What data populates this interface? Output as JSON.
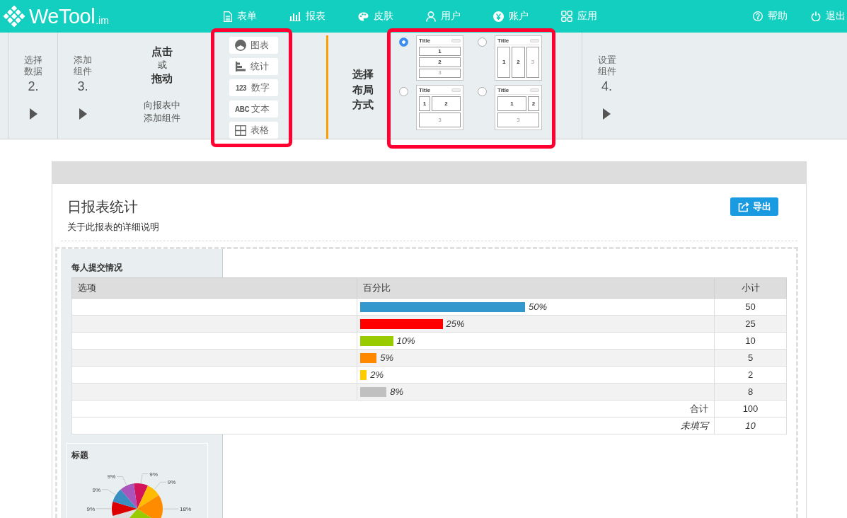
{
  "top_bar": {
    "logo": {
      "name": "WeTool",
      "suffix": ".im"
    },
    "nav": [
      {
        "kind": "form",
        "label": "表单"
      },
      {
        "kind": "report",
        "label": "报表"
      },
      {
        "kind": "skin",
        "label": "皮肤"
      },
      {
        "kind": "user",
        "label": "用户"
      },
      {
        "kind": "account",
        "label": "账户"
      },
      {
        "kind": "app",
        "label": "应用"
      }
    ],
    "actions": [
      {
        "kind": "help",
        "label": "帮助"
      },
      {
        "kind": "logout",
        "label": "退出"
      }
    ]
  },
  "toolbar": {
    "select_data_step": {
      "label": "选择数据",
      "number": "2."
    },
    "add_component_step": {
      "label": "添加组件",
      "number": "3."
    },
    "instruction": {
      "lines": [
        {
          "text": "点击",
          "bold": true
        },
        {
          "text": "或",
          "bold": false
        },
        {
          "text": "拖动",
          "bold": true
        }
      ],
      "note": "向报表中添加组件"
    },
    "components": {
      "highlighted": true,
      "items": [
        {
          "kind": "chart",
          "label": "图表"
        },
        {
          "kind": "stats",
          "label": "统计"
        },
        {
          "kind": "number",
          "glyph": "123",
          "label": "数字"
        },
        {
          "kind": "text",
          "glyph": "ABC",
          "label": "文本"
        },
        {
          "kind": "table",
          "label": "表格"
        }
      ]
    },
    "layout_picker": {
      "label": "选择布局方式",
      "highlighted": true,
      "options": [
        {
          "kind": "rows",
          "selected": true,
          "title": "Title",
          "panels": [
            "1",
            "2",
            "3"
          ]
        },
        {
          "kind": "columns",
          "selected": false,
          "title": "Title",
          "panels": [
            "1",
            "2",
            "3"
          ]
        },
        {
          "kind": "small-left",
          "selected": false,
          "title": "Title",
          "panels": [
            "1",
            "2",
            "3"
          ]
        },
        {
          "kind": "small-right",
          "selected": false,
          "title": "Title",
          "panels": [
            "1",
            "2",
            "3"
          ]
        }
      ]
    },
    "configure_step": {
      "label": "设置组件",
      "number": "4."
    }
  },
  "report": {
    "title": "日报表统计",
    "description": "关于此报表的详细说明",
    "export_button": "导出",
    "table_widget": {
      "title": "每人提交情况",
      "columns": [
        "选项",
        "百分比",
        "小计"
      ],
      "rows": [
        {
          "percent": "50%",
          "level": 0.5,
          "color": "#3399cc",
          "subtotal": "50"
        },
        {
          "percent": "25%",
          "level": 0.25,
          "color": "#ff0000",
          "subtotal": "25"
        },
        {
          "percent": "10%",
          "level": 0.1,
          "color": "#99cc00",
          "subtotal": "10"
        },
        {
          "percent": "5%",
          "level": 0.05,
          "color": "#ff8800",
          "subtotal": "5"
        },
        {
          "percent": "2%",
          "level": 0.02,
          "color": "#ffcc00",
          "subtotal": "2"
        },
        {
          "percent": "8%",
          "level": 0.08,
          "color": "#c0c0c0",
          "subtotal": "8"
        }
      ],
      "summary_rows": [
        {
          "label": "合计",
          "value": "100",
          "italic": false
        },
        {
          "label": "未填写",
          "value": "10",
          "italic": true
        }
      ]
    },
    "chart_widget": {
      "title": "标题",
      "chart_data": {
        "type": "pie",
        "values": [
          9,
          9,
          18,
          27,
          9,
          9,
          9,
          9
        ],
        "colors": [
          "#d4145a",
          "#ffbb00",
          "#ff8c00",
          "#99cc00",
          "#dddddd",
          "#dd0000",
          "#3a8fc0",
          "#aa55bb"
        ],
        "value_labels": [
          "9%",
          "9%",
          "18%",
          null,
          null,
          "9%",
          "9%",
          "9%"
        ]
      }
    }
  }
}
